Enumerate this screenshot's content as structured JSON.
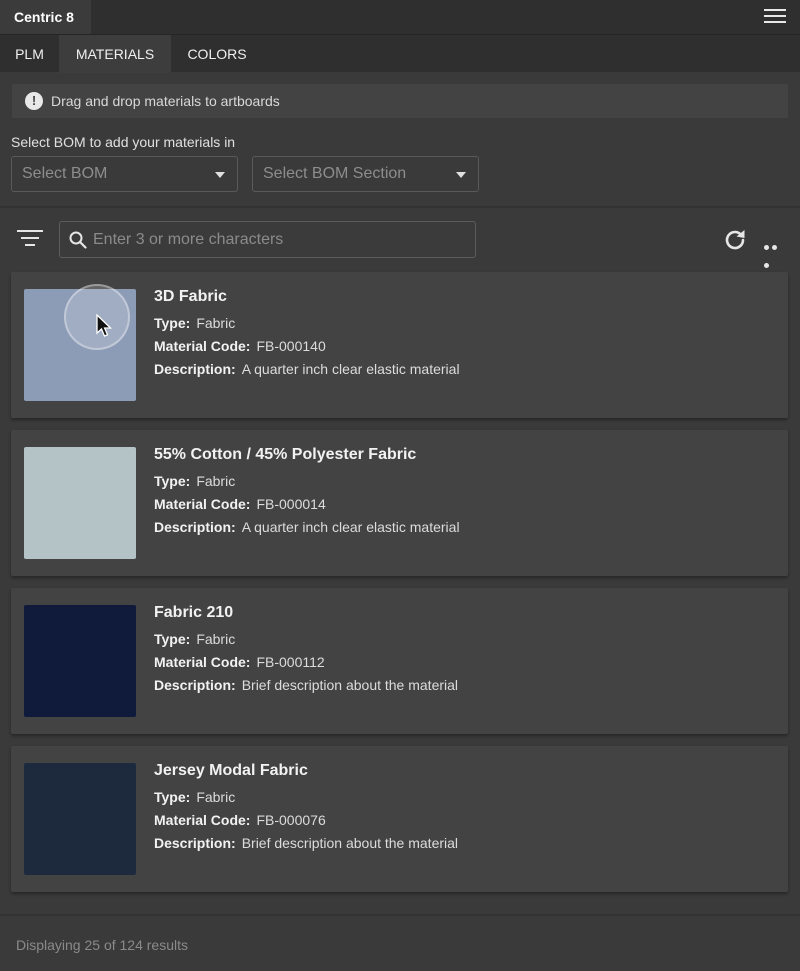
{
  "app": {
    "title": "Centric 8"
  },
  "tabs": [
    {
      "label": "PLM",
      "active": false
    },
    {
      "label": "MATERIALS",
      "active": true
    },
    {
      "label": "COLORS",
      "active": false
    }
  ],
  "info": {
    "text": "Drag and drop materials to artboards",
    "icon": "info-icon"
  },
  "bom": {
    "label": "Select BOM to add your materials in",
    "select_bom_placeholder": "Select BOM",
    "select_section_placeholder": "Select BOM Section"
  },
  "search": {
    "placeholder": "Enter 3 or more characters"
  },
  "labels": {
    "type": "Type:",
    "code": "Material Code:",
    "description": "Description:"
  },
  "materials": [
    {
      "name": "3D Fabric",
      "type": "Fabric",
      "code": "FB-000140",
      "description": "A quarter inch clear elastic material",
      "swatch": "#8c9bb6"
    },
    {
      "name": "55% Cotton / 45% Polyester Fabric",
      "type": "Fabric",
      "code": "FB-000014",
      "description": "A quarter inch clear elastic material",
      "swatch": "#b4c3c6"
    },
    {
      "name": "Fabric 210",
      "type": "Fabric",
      "code": "FB-000112",
      "description": "Brief description about the material",
      "swatch": "#101a3a"
    },
    {
      "name": "Jersey Modal Fabric",
      "type": "Fabric",
      "code": "FB-000076",
      "description": "Brief description about the material",
      "swatch": "#1d2a3e"
    }
  ],
  "footer": {
    "status": "Displaying 25 of 124 results"
  },
  "colors": {
    "background": "#3a3a3a",
    "card": "#434343",
    "header": "#2f2f2f"
  }
}
